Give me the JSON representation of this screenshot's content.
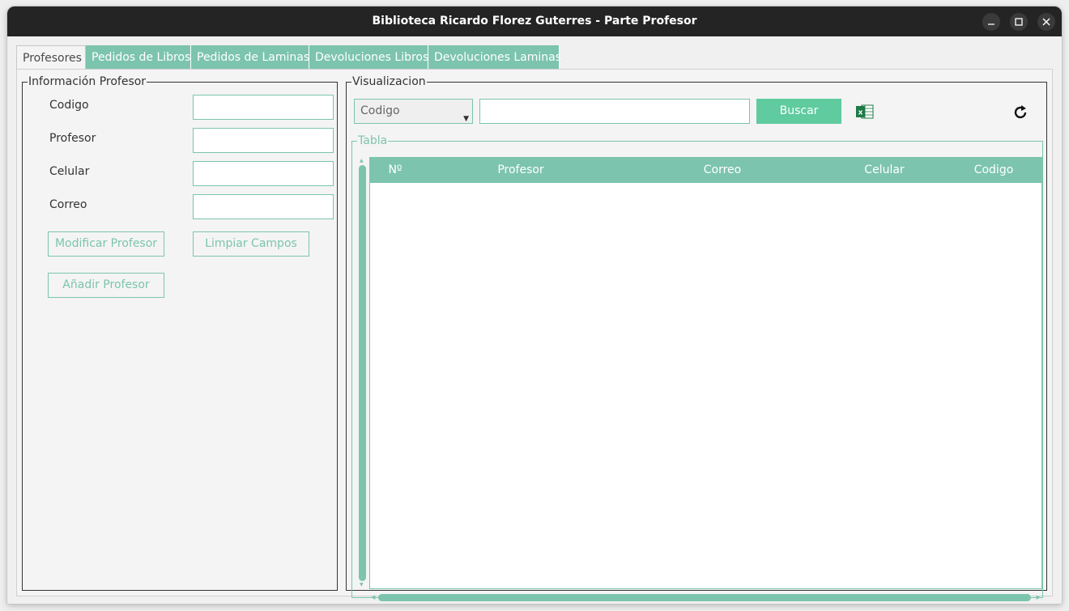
{
  "window": {
    "title": "Biblioteca Ricardo Florez Guterres - Parte Profesor",
    "minimize": "–",
    "maximize": "□",
    "close": "✕"
  },
  "tabs": [
    {
      "label": "Profesores",
      "active": true
    },
    {
      "label": "Pedidos de Libros",
      "active": false
    },
    {
      "label": "Pedidos de Laminas",
      "active": false
    },
    {
      "label": "Devoluciones Libros",
      "active": false
    },
    {
      "label": "Devoluciones Laminas",
      "active": false
    }
  ],
  "info": {
    "legend": "Información Profesor",
    "fields": [
      {
        "label": "Codigo",
        "value": ""
      },
      {
        "label": "Profesor",
        "value": ""
      },
      {
        "label": "Celular",
        "value": ""
      },
      {
        "label": "Correo",
        "value": ""
      }
    ],
    "modify_button": "Modificar Profesor",
    "clear_button": "Limpiar Campos",
    "add_button": "Añadir Profesor"
  },
  "visualizacion": {
    "legend": "Visualizacion",
    "filter_selected": "Codigo",
    "search_value": "",
    "search_button": "Buscar",
    "excel_icon": "excel-icon",
    "refresh_icon": "refresh-icon",
    "tabla_legend": "Tabla",
    "columns": [
      "Nº",
      "Profesor",
      "Correo",
      "Celular",
      "Codigo"
    ],
    "rows": []
  },
  "colors": {
    "accent": "#7cc4ad",
    "button_fill": "#5fcb9f",
    "titlebar": "#242424"
  }
}
